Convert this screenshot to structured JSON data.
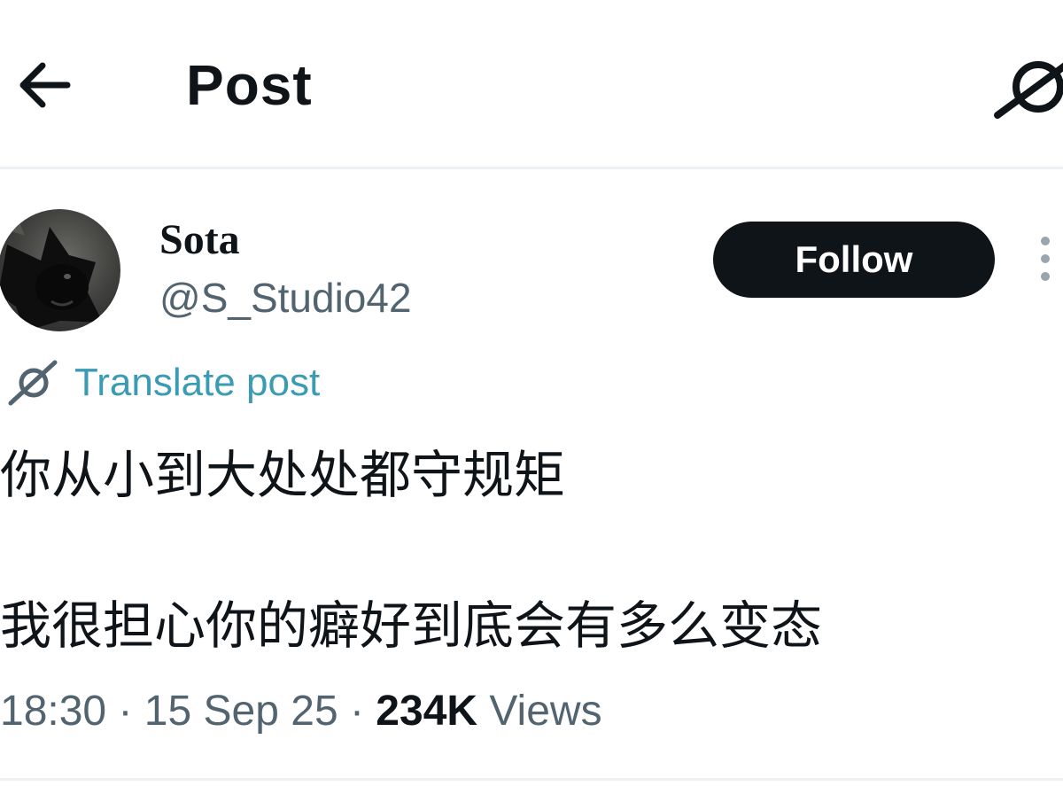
{
  "header": {
    "title": "Post",
    "back_icon": "arrow-left-icon",
    "action_icon": "grok-icon"
  },
  "author": {
    "display_name": "Sota",
    "handle": "@S_Studio42",
    "avatar_icon": "black-cat-avatar"
  },
  "follow_button": {
    "label": "Follow"
  },
  "more_icon": "more-vertical-icon",
  "translate": {
    "label": "Translate post",
    "icon": "grok-icon"
  },
  "post": {
    "lines": [
      "你从小到大处处都守规矩",
      "我很担心你的癖好到底会有多么变态"
    ]
  },
  "meta": {
    "time": "18:30",
    "separator": " · ",
    "date": "15 Sep 25",
    "views_count": "234K",
    "views_label": "Views"
  },
  "colors": {
    "text": "#0f1419",
    "secondary": "#536471",
    "translate": "#3c9bb4",
    "follow_bg": "#0f1419",
    "divider": "#eef1f3"
  }
}
